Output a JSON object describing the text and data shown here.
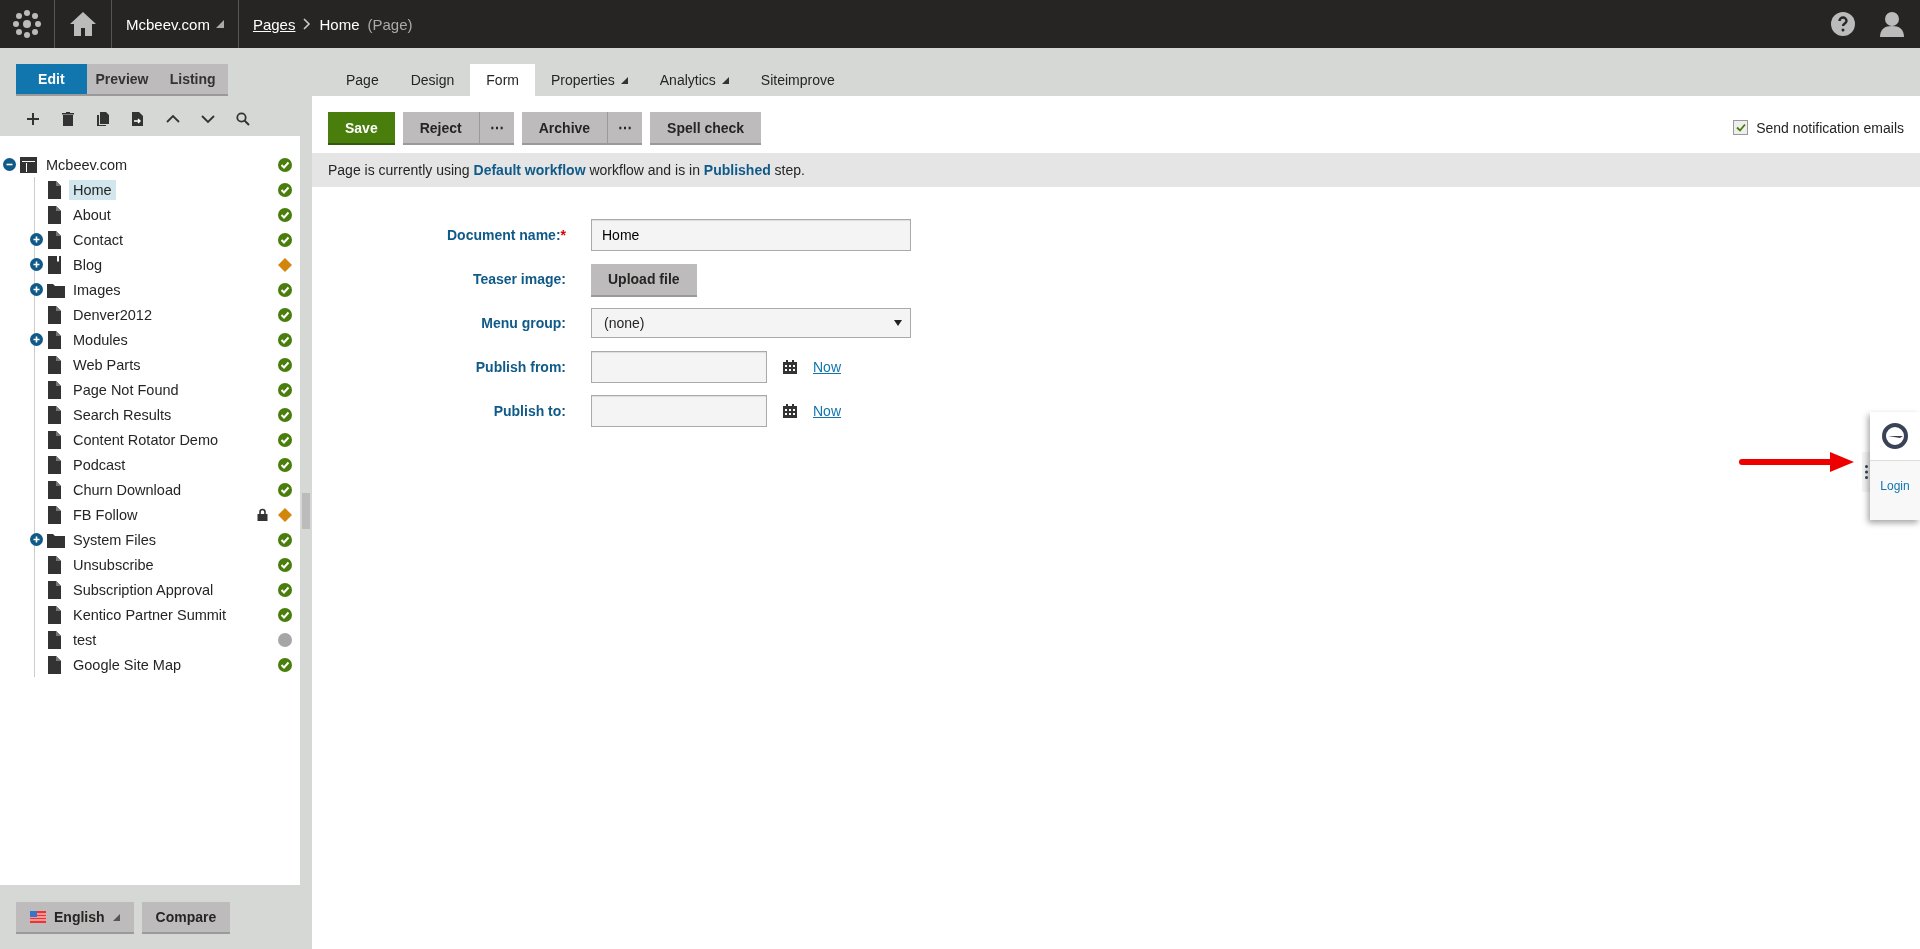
{
  "header": {
    "site": "Mcbeev.com",
    "breadcrumb": [
      {
        "text": "Pages",
        "kind": "link"
      },
      {
        "text": "Home",
        "kind": "current"
      }
    ],
    "page_type": "(Page)"
  },
  "view_modes": [
    {
      "label": "Edit",
      "selected": true
    },
    {
      "label": "Preview",
      "selected": false
    },
    {
      "label": "Listing",
      "selected": false
    }
  ],
  "tree": [
    {
      "label": "Mcbeev.com",
      "kind": "site",
      "published": true,
      "pending": false,
      "selected": false,
      "locked": false,
      "expanded": true,
      "children": [
        {
          "label": "Home",
          "kind": "page",
          "published": true,
          "pending": false,
          "selected": true,
          "locked": false
        },
        {
          "label": "About",
          "kind": "page",
          "published": true,
          "pending": false,
          "selected": false,
          "locked": false
        },
        {
          "label": "Contact",
          "kind": "page",
          "published": true,
          "pending": false,
          "selected": false,
          "locked": false,
          "expanded": false
        },
        {
          "label": "Blog",
          "kind": "blog",
          "published": false,
          "pending": true,
          "selected": false,
          "locked": false,
          "expanded": false
        },
        {
          "label": "Images",
          "kind": "folder",
          "published": true,
          "pending": false,
          "selected": false,
          "locked": false,
          "expanded": false
        },
        {
          "label": "Denver2012",
          "kind": "page",
          "published": true,
          "pending": false,
          "selected": false,
          "locked": false
        },
        {
          "label": "Modules",
          "kind": "page",
          "published": true,
          "pending": false,
          "selected": false,
          "locked": false,
          "expanded": false
        },
        {
          "label": "Web Parts",
          "kind": "page",
          "published": true,
          "pending": false,
          "selected": false,
          "locked": false
        },
        {
          "label": "Page Not Found",
          "kind": "page",
          "published": true,
          "pending": false,
          "selected": false,
          "locked": false
        },
        {
          "label": "Search Results",
          "kind": "page",
          "published": true,
          "pending": false,
          "selected": false,
          "locked": false
        },
        {
          "label": "Content Rotator Demo",
          "kind": "page",
          "published": true,
          "pending": false,
          "selected": false,
          "locked": false
        },
        {
          "label": "Podcast",
          "kind": "page",
          "published": true,
          "pending": false,
          "selected": false,
          "locked": false
        },
        {
          "label": "Churn Download",
          "kind": "page",
          "published": true,
          "pending": false,
          "selected": false,
          "locked": false
        },
        {
          "label": "FB Follow",
          "kind": "page",
          "published": false,
          "pending": true,
          "selected": false,
          "locked": true
        },
        {
          "label": "System Files",
          "kind": "folder",
          "published": true,
          "pending": false,
          "selected": false,
          "locked": false,
          "expanded": false
        },
        {
          "label": "Unsubscribe",
          "kind": "page",
          "published": true,
          "pending": false,
          "selected": false,
          "locked": false
        },
        {
          "label": "Subscription Approval",
          "kind": "page",
          "published": true,
          "pending": false,
          "selected": false,
          "locked": false
        },
        {
          "label": "Kentico Partner Summit",
          "kind": "page",
          "published": true,
          "pending": false,
          "selected": false,
          "locked": false
        },
        {
          "label": "test",
          "kind": "page",
          "published": false,
          "pending": false,
          "selected": false,
          "locked": false
        },
        {
          "label": "Google Site Map",
          "kind": "page",
          "published": true,
          "pending": false,
          "selected": false,
          "locked": false
        }
      ]
    }
  ],
  "language": "English",
  "compare": "Compare",
  "tabs": [
    {
      "label": "Page",
      "selected": false,
      "dropdown": false
    },
    {
      "label": "Design",
      "selected": false,
      "dropdown": false
    },
    {
      "label": "Form",
      "selected": true,
      "dropdown": false
    },
    {
      "label": "Properties",
      "selected": false,
      "dropdown": true
    },
    {
      "label": "Analytics",
      "selected": false,
      "dropdown": true
    },
    {
      "label": "Siteimprove",
      "selected": false,
      "dropdown": false
    }
  ],
  "actions": [
    {
      "label": "Save",
      "kind": "primary"
    },
    {
      "label": "Reject",
      "kind": "split",
      "more": "⋯"
    },
    {
      "label": "Archive",
      "kind": "split",
      "more": "⋯"
    },
    {
      "label": "Spell check",
      "kind": "plain"
    }
  ],
  "notify": {
    "label": "Send notification emails",
    "checked": true
  },
  "workflow_message": "Page is currently using **Default workflow** workflow and is in **Published** step.",
  "form": [
    {
      "label": "Document name:",
      "required": "*",
      "kind": "text",
      "value": "Home"
    },
    {
      "label": "Teaser image:",
      "kind": "upload",
      "button": "Upload file"
    },
    {
      "label": "Menu group:",
      "kind": "select",
      "value": "(none)"
    },
    {
      "label": "Publish from:",
      "kind": "date",
      "link": "Now"
    },
    {
      "label": "Publish to:",
      "kind": "date",
      "link": "Now"
    }
  ],
  "side_widget": {
    "label": "Login"
  }
}
